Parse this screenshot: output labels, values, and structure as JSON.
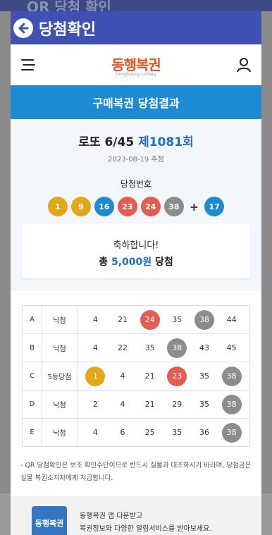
{
  "background": {
    "title": "QR 당첨 확인"
  },
  "dialog": {
    "title": "당첨확인"
  },
  "site": {
    "logo": "동행복권",
    "logo_sub": "Donghaeng Lottery"
  },
  "result_bar": "구매복권 당첨결과",
  "draw": {
    "game": "로또 6/45",
    "round": "제1081회",
    "date": "2023-08-19 추첨",
    "win_label": "당첨번호",
    "numbers": [
      "1",
      "9",
      "16",
      "23",
      "24",
      "38"
    ],
    "bonus": "17",
    "plus": "+"
  },
  "congrats": {
    "line1": "축하합니다!",
    "prefix": "총",
    "amount": "5,000원",
    "suffix": "당첨"
  },
  "games": [
    {
      "id": "A",
      "result": "낙첨",
      "numbers": [
        "4",
        "21",
        "24",
        "35",
        "38",
        "44"
      ]
    },
    {
      "id": "B",
      "result": "낙첨",
      "numbers": [
        "4",
        "22",
        "35",
        "38",
        "43",
        "45"
      ]
    },
    {
      "id": "C",
      "result": "5등당첨",
      "numbers": [
        "1",
        "4",
        "21",
        "23",
        "35",
        "38"
      ]
    },
    {
      "id": "D",
      "result": "낙첨",
      "numbers": [
        "2",
        "4",
        "21",
        "29",
        "35",
        "38"
      ]
    },
    {
      "id": "E",
      "result": "낙첨",
      "numbers": [
        "4",
        "6",
        "25",
        "35",
        "36",
        "38"
      ]
    }
  ],
  "notice": "- QR 당첨확인은 보조 확인수단이므로 반드시 실물과 대조하시기 바라며, 당첨금은 실물 복권소지자에게 지급합니다.",
  "app_banner": {
    "icon": "동행복권",
    "line1": "동행복권 앱 다운받고",
    "line2": "복권정보와 다양한 알림서비스를 받아보세요."
  },
  "colors": {
    "dialog_header": "#3f51b5",
    "result_bar": "#1d8bd4",
    "ball_1_10": "#e3a81a",
    "ball_11_20": "#1d8bd4",
    "ball_21_30": "#e35d52",
    "ball_31_40": "#8c8c8c",
    "ball_41_45": "#7cb342"
  }
}
